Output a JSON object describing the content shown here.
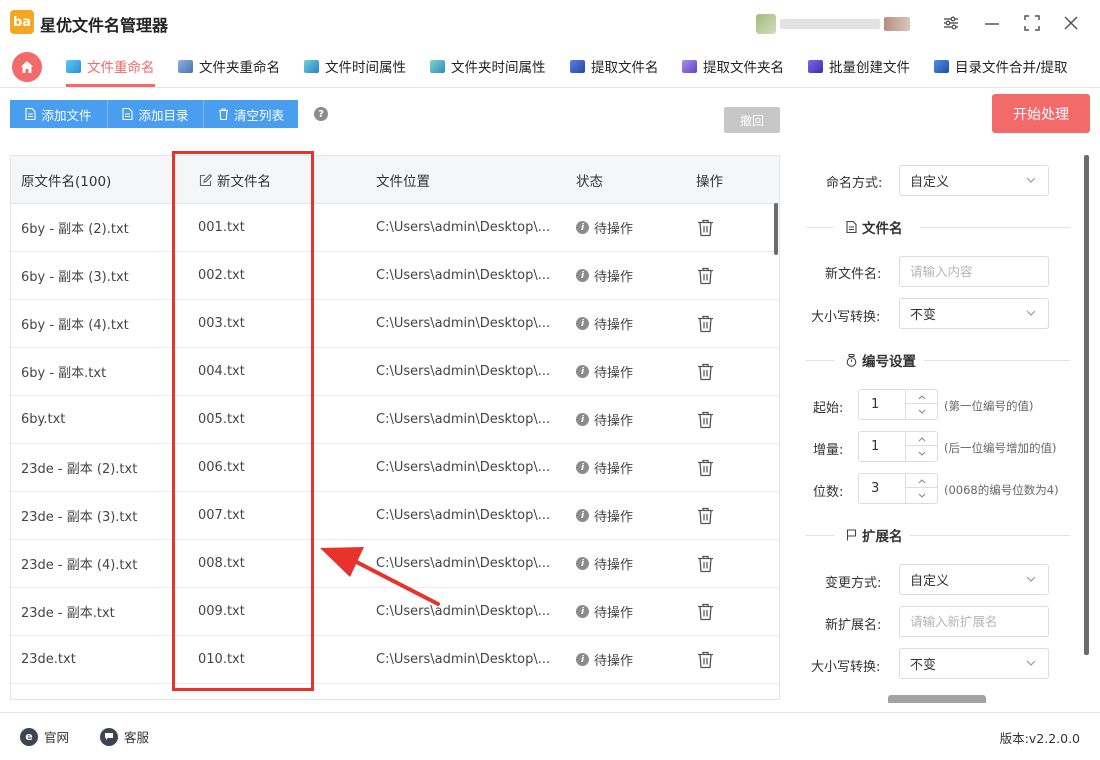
{
  "app": {
    "logo_text": "ba",
    "title": "星优文件名管理器"
  },
  "window_controls": [
    "settings-icon",
    "minimize-icon",
    "maximize-icon",
    "close-icon"
  ],
  "tabs": [
    {
      "label": "文件重命名",
      "icon": "file-rename-icon",
      "active": true
    },
    {
      "label": "文件夹重命名",
      "icon": "folder-rename-icon",
      "active": false
    },
    {
      "label": "文件时间属性",
      "icon": "file-time-icon",
      "active": false
    },
    {
      "label": "文件夹时间属性",
      "icon": "folder-time-icon",
      "active": false
    },
    {
      "label": "提取文件名",
      "icon": "extract-filename-icon",
      "active": false
    },
    {
      "label": "提取文件夹名",
      "icon": "extract-foldername-icon",
      "active": false
    },
    {
      "label": "批量创建文件",
      "icon": "batch-create-icon",
      "active": false
    },
    {
      "label": "目录文件合并/提取",
      "icon": "merge-extract-icon",
      "active": false
    }
  ],
  "toolbar": {
    "add_file": "添加文件",
    "add_dir": "添加目录",
    "clear_list": "清空列表",
    "help": "?",
    "undo": "撤回",
    "start": "开始处理"
  },
  "table": {
    "headers": {
      "original": "原文件名(100)",
      "new_name": "新文件名",
      "location": "文件位置",
      "status": "状态",
      "action": "操作"
    },
    "rows": [
      {
        "original": "6by - 副本 (2).txt",
        "new_name": "001.txt",
        "location": "C:\\Users\\admin\\Desktop\\...",
        "status": "待操作"
      },
      {
        "original": "6by - 副本 (3).txt",
        "new_name": "002.txt",
        "location": "C:\\Users\\admin\\Desktop\\...",
        "status": "待操作"
      },
      {
        "original": "6by - 副本 (4).txt",
        "new_name": "003.txt",
        "location": "C:\\Users\\admin\\Desktop\\...",
        "status": "待操作"
      },
      {
        "original": "6by - 副本.txt",
        "new_name": "004.txt",
        "location": "C:\\Users\\admin\\Desktop\\...",
        "status": "待操作"
      },
      {
        "original": "6by.txt",
        "new_name": "005.txt",
        "location": "C:\\Users\\admin\\Desktop\\...",
        "status": "待操作"
      },
      {
        "original": "23de - 副本 (2).txt",
        "new_name": "006.txt",
        "location": "C:\\Users\\admin\\Desktop\\...",
        "status": "待操作"
      },
      {
        "original": "23de - 副本 (3).txt",
        "new_name": "007.txt",
        "location": "C:\\Users\\admin\\Desktop\\...",
        "status": "待操作"
      },
      {
        "original": "23de - 副本 (4).txt",
        "new_name": "008.txt",
        "location": "C:\\Users\\admin\\Desktop\\...",
        "status": "待操作"
      },
      {
        "original": "23de - 副本.txt",
        "new_name": "009.txt",
        "location": "C:\\Users\\admin\\Desktop\\...",
        "status": "待操作"
      },
      {
        "original": "23de.txt",
        "new_name": "010.txt",
        "location": "C:\\Users\\admin\\Desktop\\...",
        "status": "待操作"
      }
    ]
  },
  "settings": {
    "naming_label": "命名方式:",
    "naming_value": "自定义",
    "filename_section": "文件名",
    "new_name_label": "新文件名:",
    "new_name_placeholder": "请输入内容",
    "case_label": "大小写转换:",
    "case_value": "不变",
    "number_section": "编号设置",
    "start_label": "起始:",
    "start_value": "1",
    "start_hint": "(第一位编号的值)",
    "step_label": "增量:",
    "step_value": "1",
    "step_hint": "(后一位编号增加的值)",
    "digits_label": "位数:",
    "digits_value": "3",
    "digits_hint": "(0068的编号位数为4)",
    "ext_section": "扩展名",
    "ext_mode_label": "变更方式:",
    "ext_mode_value": "自定义",
    "new_ext_label": "新扩展名:",
    "new_ext_placeholder": "请输入新扩展名",
    "ext_case_label": "大小写转换:",
    "ext_case_value": "不变"
  },
  "footer": {
    "website": "官网",
    "website_icon": "e",
    "support": "客服",
    "version": "版本:v2.2.0.0"
  },
  "colors": {
    "accent": "#f26a6a",
    "primary": "#4a9ef0",
    "highlight_red": "#e8322c"
  }
}
